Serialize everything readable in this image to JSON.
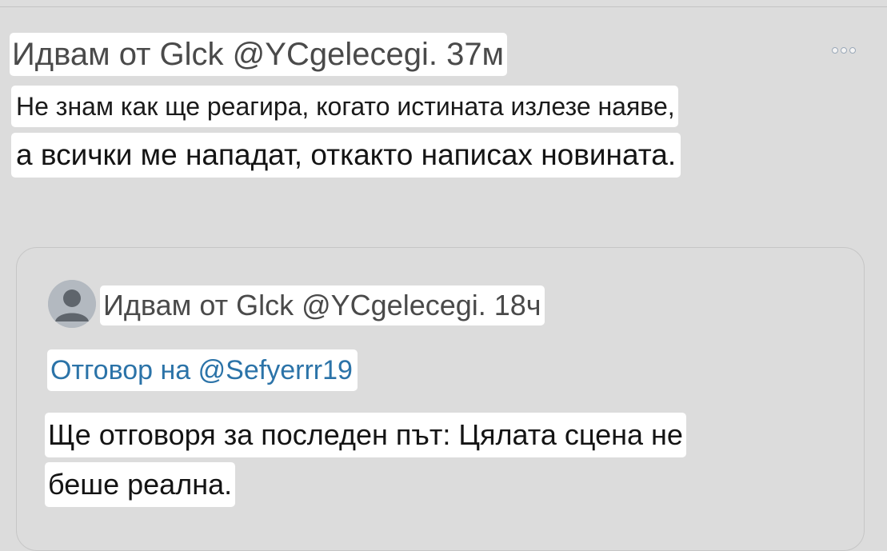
{
  "post": {
    "header": "Идвам от Glck @YCgelecegi. 37м",
    "text_line1": "Не знам как ще реагира, когато истината излезе наяве,",
    "text_line2": "а всички ме нападат, откакто написах новината.",
    "more_icon": "more-horizontal-icon"
  },
  "quoted": {
    "avatar_icon": "default-avatar-icon",
    "header": "Идвам от Glck @YCgelecegi. 18ч",
    "reply_to": "Отговор на @Sefyerrr19",
    "text_line1": "Ще отговоря за последен път: Цялата сцена не",
    "text_line2": "беше реална."
  },
  "colors": {
    "background": "#dcdcdc",
    "highlight": "#ffffff",
    "link": "#2b73a8",
    "muted_text": "#4a4a4a"
  }
}
